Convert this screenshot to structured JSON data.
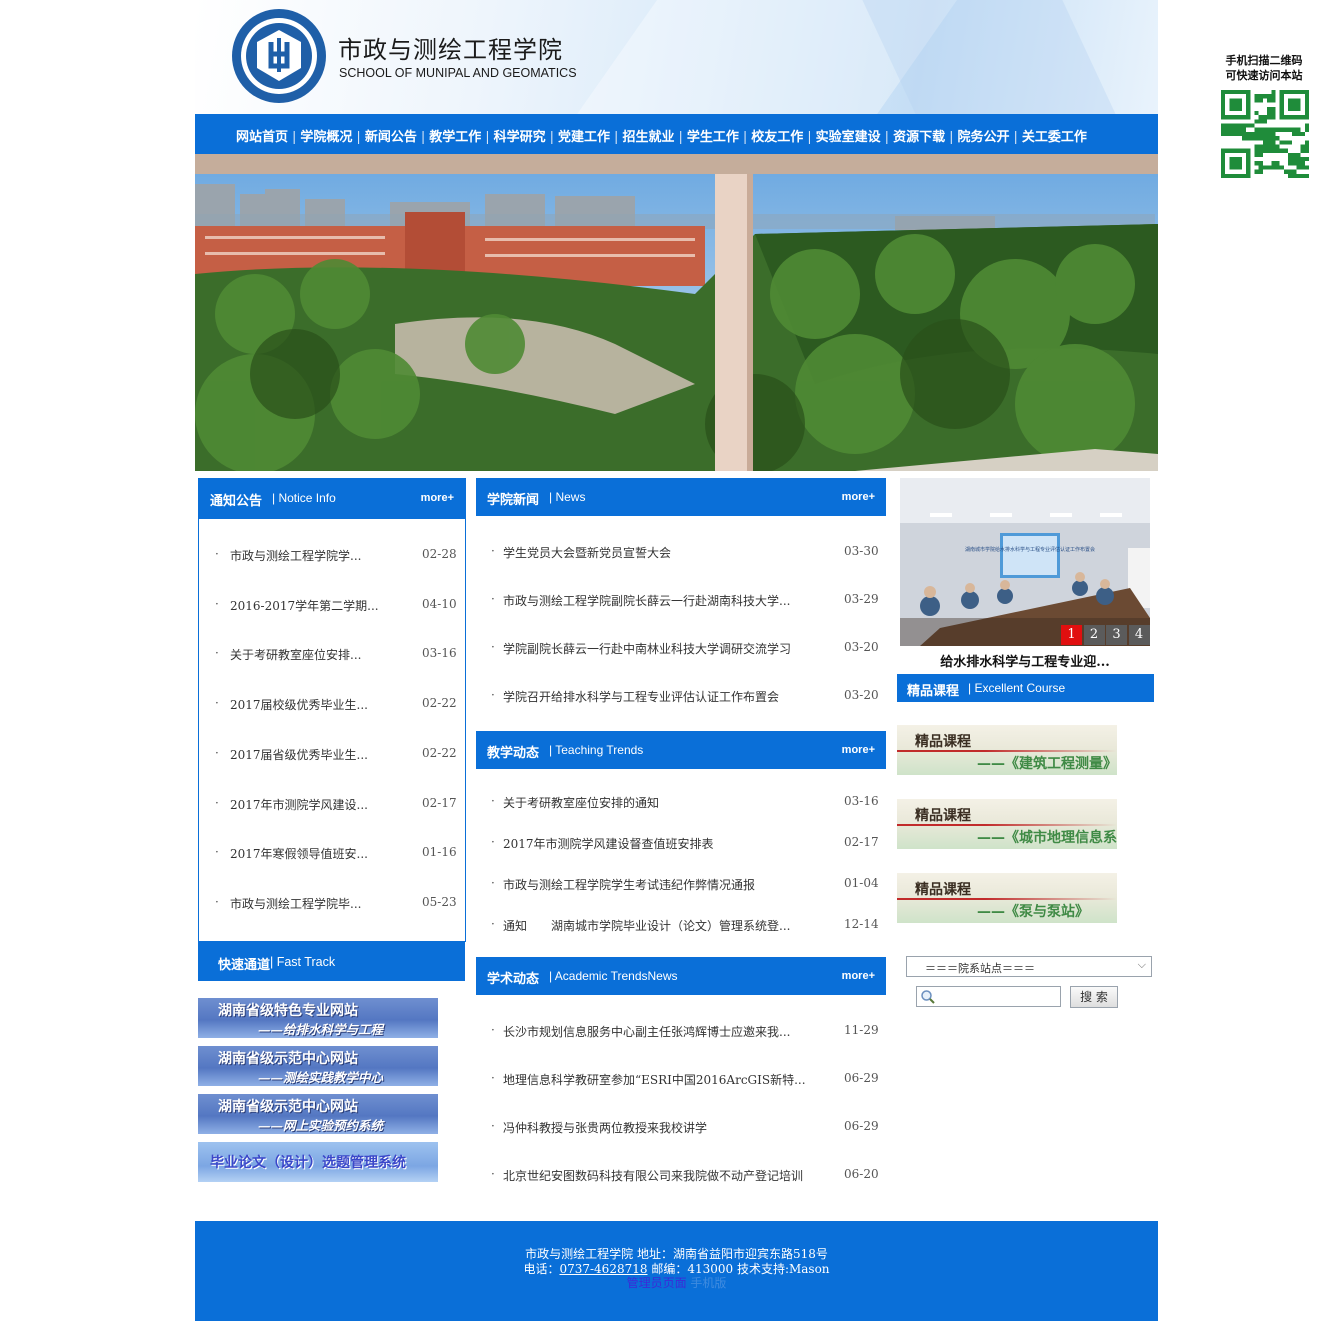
{
  "header": {
    "title": "市政与测绘工程学院",
    "subtitle": "SCHOOL OF MUNIPAL AND GEOMATICS",
    "logo_text": "湖南城市学院市政与测绘工程学院 SCHOOL OF MUNIPAL AND GEOMATICS ENGINEERING"
  },
  "nav": {
    "items": [
      "网站首页",
      "学院概况",
      "新闻公告",
      "教学工作",
      "科学研究",
      "党建工作",
      "招生就业",
      "学生工作",
      "校友工作",
      "实验室建设",
      "资源下载",
      "院务公开",
      "关工委工作"
    ],
    "separator": "|"
  },
  "qr": {
    "caption_line1": "手机扫描二维码",
    "caption_line2": "可快速访问本站"
  },
  "notice": {
    "title_cn": "通知公告",
    "title_en": "| Notice Info",
    "more": "more+",
    "items": [
      {
        "title": "市政与测绘工程学院学...",
        "date": "02-28"
      },
      {
        "title": "2016-2017学年第二学期...",
        "date": "04-10"
      },
      {
        "title": "关于考研教室座位安排...",
        "date": "03-16"
      },
      {
        "title": "2017届校级优秀毕业生...",
        "date": "02-22"
      },
      {
        "title": "2017届省级优秀毕业生...",
        "date": "02-22"
      },
      {
        "title": "2017年市测院学风建设...",
        "date": "02-17"
      },
      {
        "title": "2017年寒假领导值班安...",
        "date": "01-16"
      },
      {
        "title": "市政与测绘工程学院毕...",
        "date": "05-23"
      }
    ]
  },
  "quick": {
    "title_cn": "快速通道",
    "title_en": "| Fast Track",
    "links": [
      {
        "line1": "湖南省级特色专业网站",
        "line2": "——给排水科学与工程"
      },
      {
        "line1": "湖南省级示范中心网站",
        "line2": "——测绘实践教学中心"
      },
      {
        "line1": "湖南省级示范中心网站",
        "line2": "——网上实验预约系统"
      },
      {
        "line1": "毕业论文（设计）选题管理系统",
        "line2": ""
      }
    ]
  },
  "news": {
    "title_cn": "学院新闻",
    "title_en": "| News",
    "more": "more+",
    "items": [
      {
        "title": "学生党员大会暨新党员宣誓大会",
        "date": "03-30"
      },
      {
        "title": "市政与测绘工程学院副院长薛云一行赴湖南科技大学...",
        "date": "03-29"
      },
      {
        "title": "学院副院长薛云一行赴中南林业科技大学调研交流学习",
        "date": "03-20"
      },
      {
        "title": "学院召开给排水科学与工程专业评估认证工作布置会",
        "date": "03-20"
      }
    ]
  },
  "teaching": {
    "title_cn": "教学动态",
    "title_en": "| Teaching Trends",
    "more": "more+",
    "items": [
      {
        "title": "关于考研教室座位安排的通知",
        "date": "03-16"
      },
      {
        "title": "2017年市测院学风建设督查值班安排表",
        "date": "02-17"
      },
      {
        "title": "市政与测绘工程学院学生考试违纪作弊情况通报",
        "date": "01-04"
      },
      {
        "title": "通知　　湖南城市学院毕业设计（论文）管理系统登...",
        "date": "12-14"
      }
    ]
  },
  "academic": {
    "title_cn": "学术动态",
    "title_en": "| Academic TrendsNews",
    "more": "more+",
    "items": [
      {
        "title": "长沙市规划信息服务中心副主任张鸿辉博士应邀来我...",
        "date": "11-29"
      },
      {
        "title": "地理信息科学教研室参加“ESRI中国2016ArcGIS新特...",
        "date": "06-29"
      },
      {
        "title": "冯仲科教授与张贵两位教授来我校讲学",
        "date": "06-29"
      },
      {
        "title": "北京世纪安图数码科技有限公司来我院做不动产登记培训",
        "date": "06-20"
      }
    ]
  },
  "slideshow": {
    "caption": "给水排水科学与工程专业迎...",
    "pages": [
      "1",
      "2",
      "3",
      "4"
    ],
    "active_page": 1,
    "slide_text": "湖南城市学院给水排水科学与工程专业评估认证工作布置会"
  },
  "courses": {
    "title_cn": "精品课程",
    "title_en": "| Excellent Course",
    "items": [
      {
        "label": "精品课程",
        "name": "——《建筑工程测量》"
      },
      {
        "label": "精品课程",
        "name": "——《城市地理信息系统》"
      },
      {
        "label": "精品课程",
        "name": "——《泵与泵站》"
      }
    ]
  },
  "search": {
    "station_select": "＝＝＝院系站点＝＝＝",
    "button": "搜 索"
  },
  "footer": {
    "line1": "市政与测绘工程学院  地址：湖南省益阳市迎宾东路518号",
    "phone_label": "电话：",
    "phone": "0737-4628718",
    "line2_rest": "  邮编：413000 技术支持:Mason",
    "admin": "管理员页面",
    "mobile": "手机版"
  },
  "colors": {
    "primary": "#0a6fd8",
    "pager_active": "#e10f0f",
    "pager": "#5b5b5b"
  }
}
